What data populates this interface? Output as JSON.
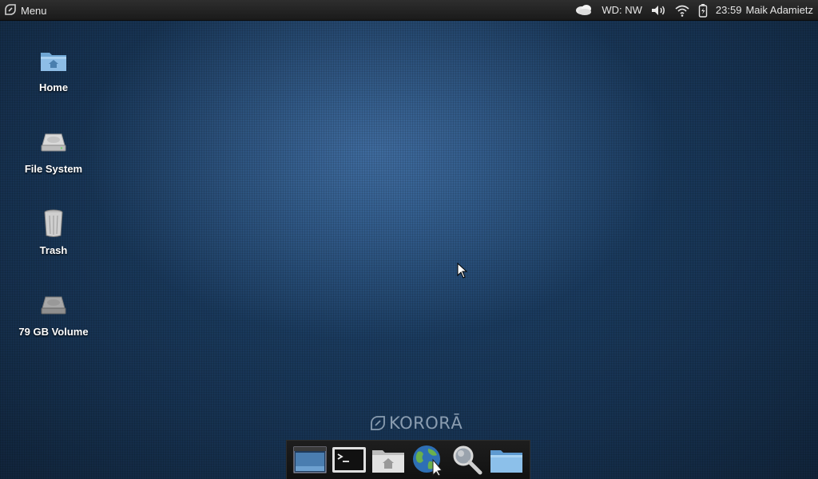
{
  "panel": {
    "menu_label": "Menu",
    "weather_label": "WD: NW",
    "clock": "23:59",
    "user": "Maik Adamietz",
    "icons": [
      "kororaa-logo-icon",
      "weather-cloud-icon",
      "volume-icon",
      "wifi-icon",
      "battery-icon"
    ]
  },
  "desktop": {
    "icons": [
      {
        "label": "Home",
        "icon": "home-folder-icon"
      },
      {
        "label": "File System",
        "icon": "hard-drive-icon"
      },
      {
        "label": "Trash",
        "icon": "trash-icon"
      },
      {
        "label": "79 GB Volume",
        "icon": "volume-drive-icon"
      }
    ]
  },
  "logo": {
    "text": "KORORĀ"
  },
  "dock": {
    "items": [
      "desktop-icon",
      "terminal-icon",
      "home-folder-icon",
      "web-browser-icon",
      "search-icon",
      "folder-icon"
    ]
  },
  "colors": {
    "panel": "#232323",
    "wallpaper": "#1c3b5e",
    "accent": "#6aa3d6"
  }
}
